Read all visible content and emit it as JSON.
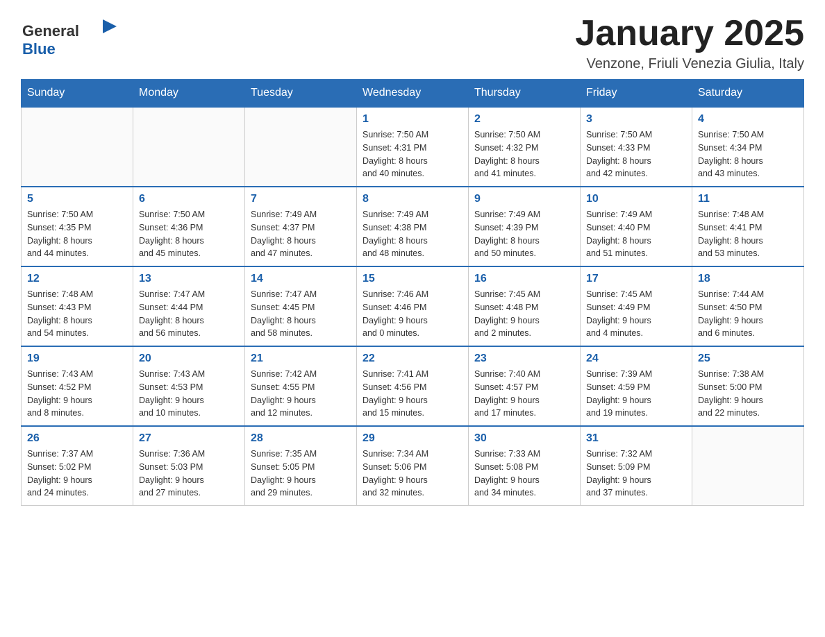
{
  "header": {
    "logo_general": "General",
    "logo_blue": "Blue",
    "month_title": "January 2025",
    "location": "Venzone, Friuli Venezia Giulia, Italy"
  },
  "weekdays": [
    "Sunday",
    "Monday",
    "Tuesday",
    "Wednesday",
    "Thursday",
    "Friday",
    "Saturday"
  ],
  "weeks": [
    [
      {
        "day": "",
        "sunrise": "",
        "sunset": "",
        "daylight": ""
      },
      {
        "day": "",
        "sunrise": "",
        "sunset": "",
        "daylight": ""
      },
      {
        "day": "",
        "sunrise": "",
        "sunset": "",
        "daylight": ""
      },
      {
        "day": "1",
        "sunrise": "Sunrise: 7:50 AM",
        "sunset": "Sunset: 4:31 PM",
        "daylight": "Daylight: 8 hours and 40 minutes."
      },
      {
        "day": "2",
        "sunrise": "Sunrise: 7:50 AM",
        "sunset": "Sunset: 4:32 PM",
        "daylight": "Daylight: 8 hours and 41 minutes."
      },
      {
        "day": "3",
        "sunrise": "Sunrise: 7:50 AM",
        "sunset": "Sunset: 4:33 PM",
        "daylight": "Daylight: 8 hours and 42 minutes."
      },
      {
        "day": "4",
        "sunrise": "Sunrise: 7:50 AM",
        "sunset": "Sunset: 4:34 PM",
        "daylight": "Daylight: 8 hours and 43 minutes."
      }
    ],
    [
      {
        "day": "5",
        "sunrise": "Sunrise: 7:50 AM",
        "sunset": "Sunset: 4:35 PM",
        "daylight": "Daylight: 8 hours and 44 minutes."
      },
      {
        "day": "6",
        "sunrise": "Sunrise: 7:50 AM",
        "sunset": "Sunset: 4:36 PM",
        "daylight": "Daylight: 8 hours and 45 minutes."
      },
      {
        "day": "7",
        "sunrise": "Sunrise: 7:49 AM",
        "sunset": "Sunset: 4:37 PM",
        "daylight": "Daylight: 8 hours and 47 minutes."
      },
      {
        "day": "8",
        "sunrise": "Sunrise: 7:49 AM",
        "sunset": "Sunset: 4:38 PM",
        "daylight": "Daylight: 8 hours and 48 minutes."
      },
      {
        "day": "9",
        "sunrise": "Sunrise: 7:49 AM",
        "sunset": "Sunset: 4:39 PM",
        "daylight": "Daylight: 8 hours and 50 minutes."
      },
      {
        "day": "10",
        "sunrise": "Sunrise: 7:49 AM",
        "sunset": "Sunset: 4:40 PM",
        "daylight": "Daylight: 8 hours and 51 minutes."
      },
      {
        "day": "11",
        "sunrise": "Sunrise: 7:48 AM",
        "sunset": "Sunset: 4:41 PM",
        "daylight": "Daylight: 8 hours and 53 minutes."
      }
    ],
    [
      {
        "day": "12",
        "sunrise": "Sunrise: 7:48 AM",
        "sunset": "Sunset: 4:43 PM",
        "daylight": "Daylight: 8 hours and 54 minutes."
      },
      {
        "day": "13",
        "sunrise": "Sunrise: 7:47 AM",
        "sunset": "Sunset: 4:44 PM",
        "daylight": "Daylight: 8 hours and 56 minutes."
      },
      {
        "day": "14",
        "sunrise": "Sunrise: 7:47 AM",
        "sunset": "Sunset: 4:45 PM",
        "daylight": "Daylight: 8 hours and 58 minutes."
      },
      {
        "day": "15",
        "sunrise": "Sunrise: 7:46 AM",
        "sunset": "Sunset: 4:46 PM",
        "daylight": "Daylight: 9 hours and 0 minutes."
      },
      {
        "day": "16",
        "sunrise": "Sunrise: 7:45 AM",
        "sunset": "Sunset: 4:48 PM",
        "daylight": "Daylight: 9 hours and 2 minutes."
      },
      {
        "day": "17",
        "sunrise": "Sunrise: 7:45 AM",
        "sunset": "Sunset: 4:49 PM",
        "daylight": "Daylight: 9 hours and 4 minutes."
      },
      {
        "day": "18",
        "sunrise": "Sunrise: 7:44 AM",
        "sunset": "Sunset: 4:50 PM",
        "daylight": "Daylight: 9 hours and 6 minutes."
      }
    ],
    [
      {
        "day": "19",
        "sunrise": "Sunrise: 7:43 AM",
        "sunset": "Sunset: 4:52 PM",
        "daylight": "Daylight: 9 hours and 8 minutes."
      },
      {
        "day": "20",
        "sunrise": "Sunrise: 7:43 AM",
        "sunset": "Sunset: 4:53 PM",
        "daylight": "Daylight: 9 hours and 10 minutes."
      },
      {
        "day": "21",
        "sunrise": "Sunrise: 7:42 AM",
        "sunset": "Sunset: 4:55 PM",
        "daylight": "Daylight: 9 hours and 12 minutes."
      },
      {
        "day": "22",
        "sunrise": "Sunrise: 7:41 AM",
        "sunset": "Sunset: 4:56 PM",
        "daylight": "Daylight: 9 hours and 15 minutes."
      },
      {
        "day": "23",
        "sunrise": "Sunrise: 7:40 AM",
        "sunset": "Sunset: 4:57 PM",
        "daylight": "Daylight: 9 hours and 17 minutes."
      },
      {
        "day": "24",
        "sunrise": "Sunrise: 7:39 AM",
        "sunset": "Sunset: 4:59 PM",
        "daylight": "Daylight: 9 hours and 19 minutes."
      },
      {
        "day": "25",
        "sunrise": "Sunrise: 7:38 AM",
        "sunset": "Sunset: 5:00 PM",
        "daylight": "Daylight: 9 hours and 22 minutes."
      }
    ],
    [
      {
        "day": "26",
        "sunrise": "Sunrise: 7:37 AM",
        "sunset": "Sunset: 5:02 PM",
        "daylight": "Daylight: 9 hours and 24 minutes."
      },
      {
        "day": "27",
        "sunrise": "Sunrise: 7:36 AM",
        "sunset": "Sunset: 5:03 PM",
        "daylight": "Daylight: 9 hours and 27 minutes."
      },
      {
        "day": "28",
        "sunrise": "Sunrise: 7:35 AM",
        "sunset": "Sunset: 5:05 PM",
        "daylight": "Daylight: 9 hours and 29 minutes."
      },
      {
        "day": "29",
        "sunrise": "Sunrise: 7:34 AM",
        "sunset": "Sunset: 5:06 PM",
        "daylight": "Daylight: 9 hours and 32 minutes."
      },
      {
        "day": "30",
        "sunrise": "Sunrise: 7:33 AM",
        "sunset": "Sunset: 5:08 PM",
        "daylight": "Daylight: 9 hours and 34 minutes."
      },
      {
        "day": "31",
        "sunrise": "Sunrise: 7:32 AM",
        "sunset": "Sunset: 5:09 PM",
        "daylight": "Daylight: 9 hours and 37 minutes."
      },
      {
        "day": "",
        "sunrise": "",
        "sunset": "",
        "daylight": ""
      }
    ]
  ]
}
